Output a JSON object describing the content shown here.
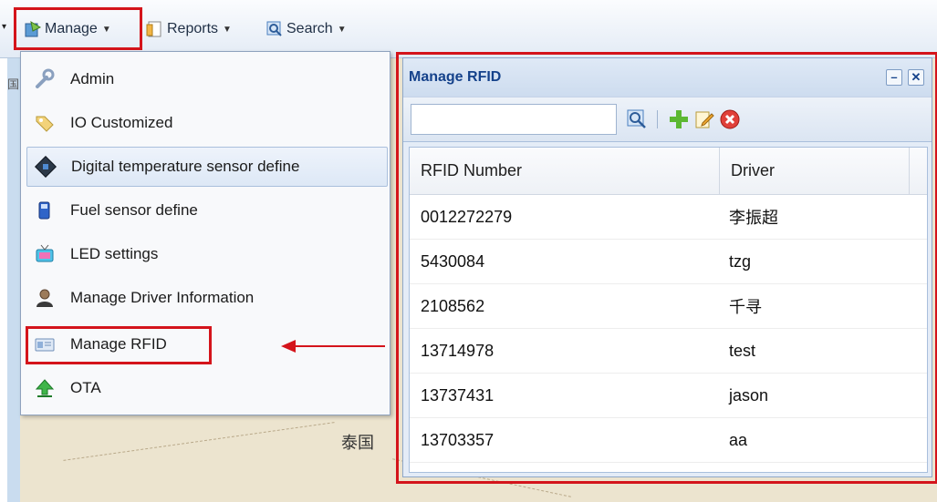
{
  "toolbar": {
    "manage_label": "Manage",
    "reports_label": "Reports",
    "search_label": "Search"
  },
  "map": {
    "labels": [
      "国",
      "泰国"
    ]
  },
  "menu": {
    "items": [
      {
        "label": "Admin",
        "icon": "wrench-icon"
      },
      {
        "label": "IO Customized",
        "icon": "tag-icon"
      },
      {
        "label": "Digital temperature sensor define",
        "icon": "sensor-chip-icon"
      },
      {
        "label": "Fuel sensor define",
        "icon": "fuel-pump-icon"
      },
      {
        "label": "LED settings",
        "icon": "tv-icon"
      },
      {
        "label": "Manage Driver Information",
        "icon": "driver-icon"
      },
      {
        "label": "Manage RFID",
        "icon": "id-card-icon"
      },
      {
        "label": "OTA",
        "icon": "upload-arrow-icon"
      }
    ]
  },
  "window": {
    "title": "Manage RFID",
    "search_value": "",
    "columns": [
      "RFID Number",
      "Driver"
    ],
    "rows": [
      {
        "rfid": "0012272279",
        "driver": "李振超"
      },
      {
        "rfid": "5430084",
        "driver": "tzg"
      },
      {
        "rfid": "2108562",
        "driver": "千寻"
      },
      {
        "rfid": "13714978",
        "driver": "test"
      },
      {
        "rfid": "13737431",
        "driver": "jason"
      },
      {
        "rfid": "13703357",
        "driver": "aa"
      }
    ]
  },
  "colors": {
    "highlight_red": "#d4141b",
    "title_blue": "#15428b",
    "map_land": "#ece4cf"
  }
}
